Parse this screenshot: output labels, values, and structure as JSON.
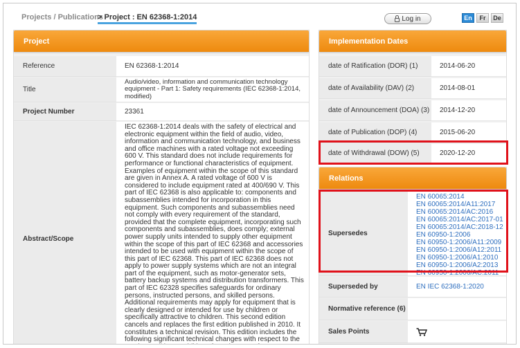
{
  "breadcrumb": {
    "parent": "Projects / Publications",
    "current": "> Project : EN 62368-1:2014"
  },
  "header": {
    "login_label": "Log in",
    "languages": [
      "En",
      "Fr",
      "De"
    ],
    "active_language": "En"
  },
  "project": {
    "title": "Project",
    "rows": {
      "reference": {
        "label": "Reference",
        "value": "EN 62368-1:2014"
      },
      "title": {
        "label": "Title",
        "value": "Audio/video, information and communication technology equipment - Part 1: Safety requirements (IEC 62368-1:2014, modified)"
      },
      "number": {
        "label": "Project Number",
        "value": "23361"
      },
      "abstract": {
        "label": "Abstract/Scope",
        "value": "IEC 62368-1:2014 deals with the safety of electrical and electronic equipment within the field of audio, video, information and communication technology, and business and office machines with a rated voltage not exceeding 600 V. This standard does not include requirements for performance or functional characteristics of equipment. Examples of equipment within the scope of this standard are given in Annex A. A rated voltage of 600 V is considered to include equipment rated at 400/690 V. This part of IEC 62368 is also applicable to: components and subassemblies intended for incorporation in this equipment. Such components and subassemblies need not comply with every requirement of the standard, provided that the complete equipment, incorporating such components and subassemblies, does comply; external power supply units intended to supply other equipment within the scope of this part of IEC 62368 and accessories intended to be used with equipment within the scope of this part of IEC 62368. This part of IEC 62368 does not apply to power supply systems which are not an integral part of the equipment, such as motor-generator sets, battery backup systems and distribution transformers. This part of IEC 62328 specifies safeguards for ordinary persons, instructed persons, and skilled persons. Additional requirements may apply for equipment that is clearly designed or intended for use by children or specifically attractive to children. This second edition cancels and replaces the first edition published in 2010. It constitutes a technical revision. This edition includes the following significant technical changes with respect to the previous edition: - addition of requirements for LEDs; - new requirements for wall and ceiling mounting means; - addition of acoustic shock requirements for personal music players; - revision of the battery requirements, including new"
      }
    }
  },
  "implementation": {
    "title": "Implementation Dates",
    "rows": [
      {
        "label": "date of Ratification (DOR) (1)",
        "value": "2014-06-20"
      },
      {
        "label": "date of Availability (DAV) (2)",
        "value": "2014-08-01"
      },
      {
        "label": "date of Announcement (DOA) (3)",
        "value": "2014-12-20"
      },
      {
        "label": "date of Publication (DOP) (4)",
        "value": "2015-06-20"
      },
      {
        "label": "date of Withdrawal (DOW) (5)",
        "value": "2020-12-20"
      }
    ]
  },
  "relations": {
    "title": "Relations",
    "supersedes": {
      "label": "Supersedes",
      "links": [
        "EN 60065:2014",
        "EN 60065:2014/A11:2017",
        "EN 60065:2014/AC:2016",
        "EN 60065:2014/AC:2017-01",
        "EN 60065:2014/AC:2018-12",
        "EN 60950-1:2006",
        "EN 60950-1:2006/A11:2009",
        "EN 60950-1:2006/A12:2011",
        "EN 60950-1:2006/A1:2010",
        "EN 60950-1:2006/A2:2013",
        "EN 60950-1:2006/AC:2011"
      ]
    },
    "superseded_by": {
      "label": "Superseded by",
      "value": "EN IEC 62368-1:2020"
    },
    "normative": {
      "label": "Normative reference (6)"
    },
    "sales": {
      "label": "Sales Points"
    }
  },
  "colors": {
    "accent": "#f0900f",
    "link": "#2f6fbf",
    "highlight": "#e0111a",
    "active_language": "#2b8ad6"
  },
  "icons": {
    "login": "lock-icon",
    "sales": "cart-icon"
  }
}
